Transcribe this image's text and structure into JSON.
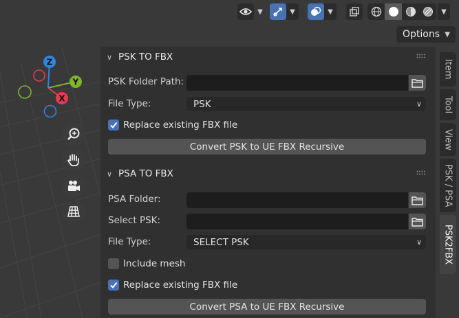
{
  "header": {
    "options_label": "Options"
  },
  "gizmo": {
    "x": "X",
    "y": "Y",
    "z": "Z",
    "colors": {
      "x": "#e8394f",
      "y": "#7fb42f",
      "z": "#2f86e0"
    }
  },
  "psk_panel": {
    "title": "PSK TO FBX",
    "folder_label": "PSK Folder Path:",
    "folder_value": "",
    "file_type_label": "File Type:",
    "file_type_value": "PSK",
    "replace_label": "Replace existing FBX file",
    "replace_checked": true,
    "convert_label": "Convert PSK to UE FBX Recursive"
  },
  "psa_panel": {
    "title": "PSA TO FBX",
    "folder_label": "PSA Folder:",
    "folder_value": "",
    "select_psk_label": "Select PSK:",
    "select_psk_value": "",
    "file_type_label": "File Type:",
    "file_type_value": "SELECT PSK",
    "include_mesh_label": "Include mesh",
    "include_mesh_checked": false,
    "replace_label": "Replace existing FBX file",
    "replace_checked": true,
    "convert_label": "Convert PSA to UE FBX Recursive"
  },
  "tabs": [
    "Item",
    "Tool",
    "View",
    "PSK / PSA",
    "PSK2FBX"
  ],
  "active_tab": "PSK2FBX",
  "accent_color": "#4772b3"
}
